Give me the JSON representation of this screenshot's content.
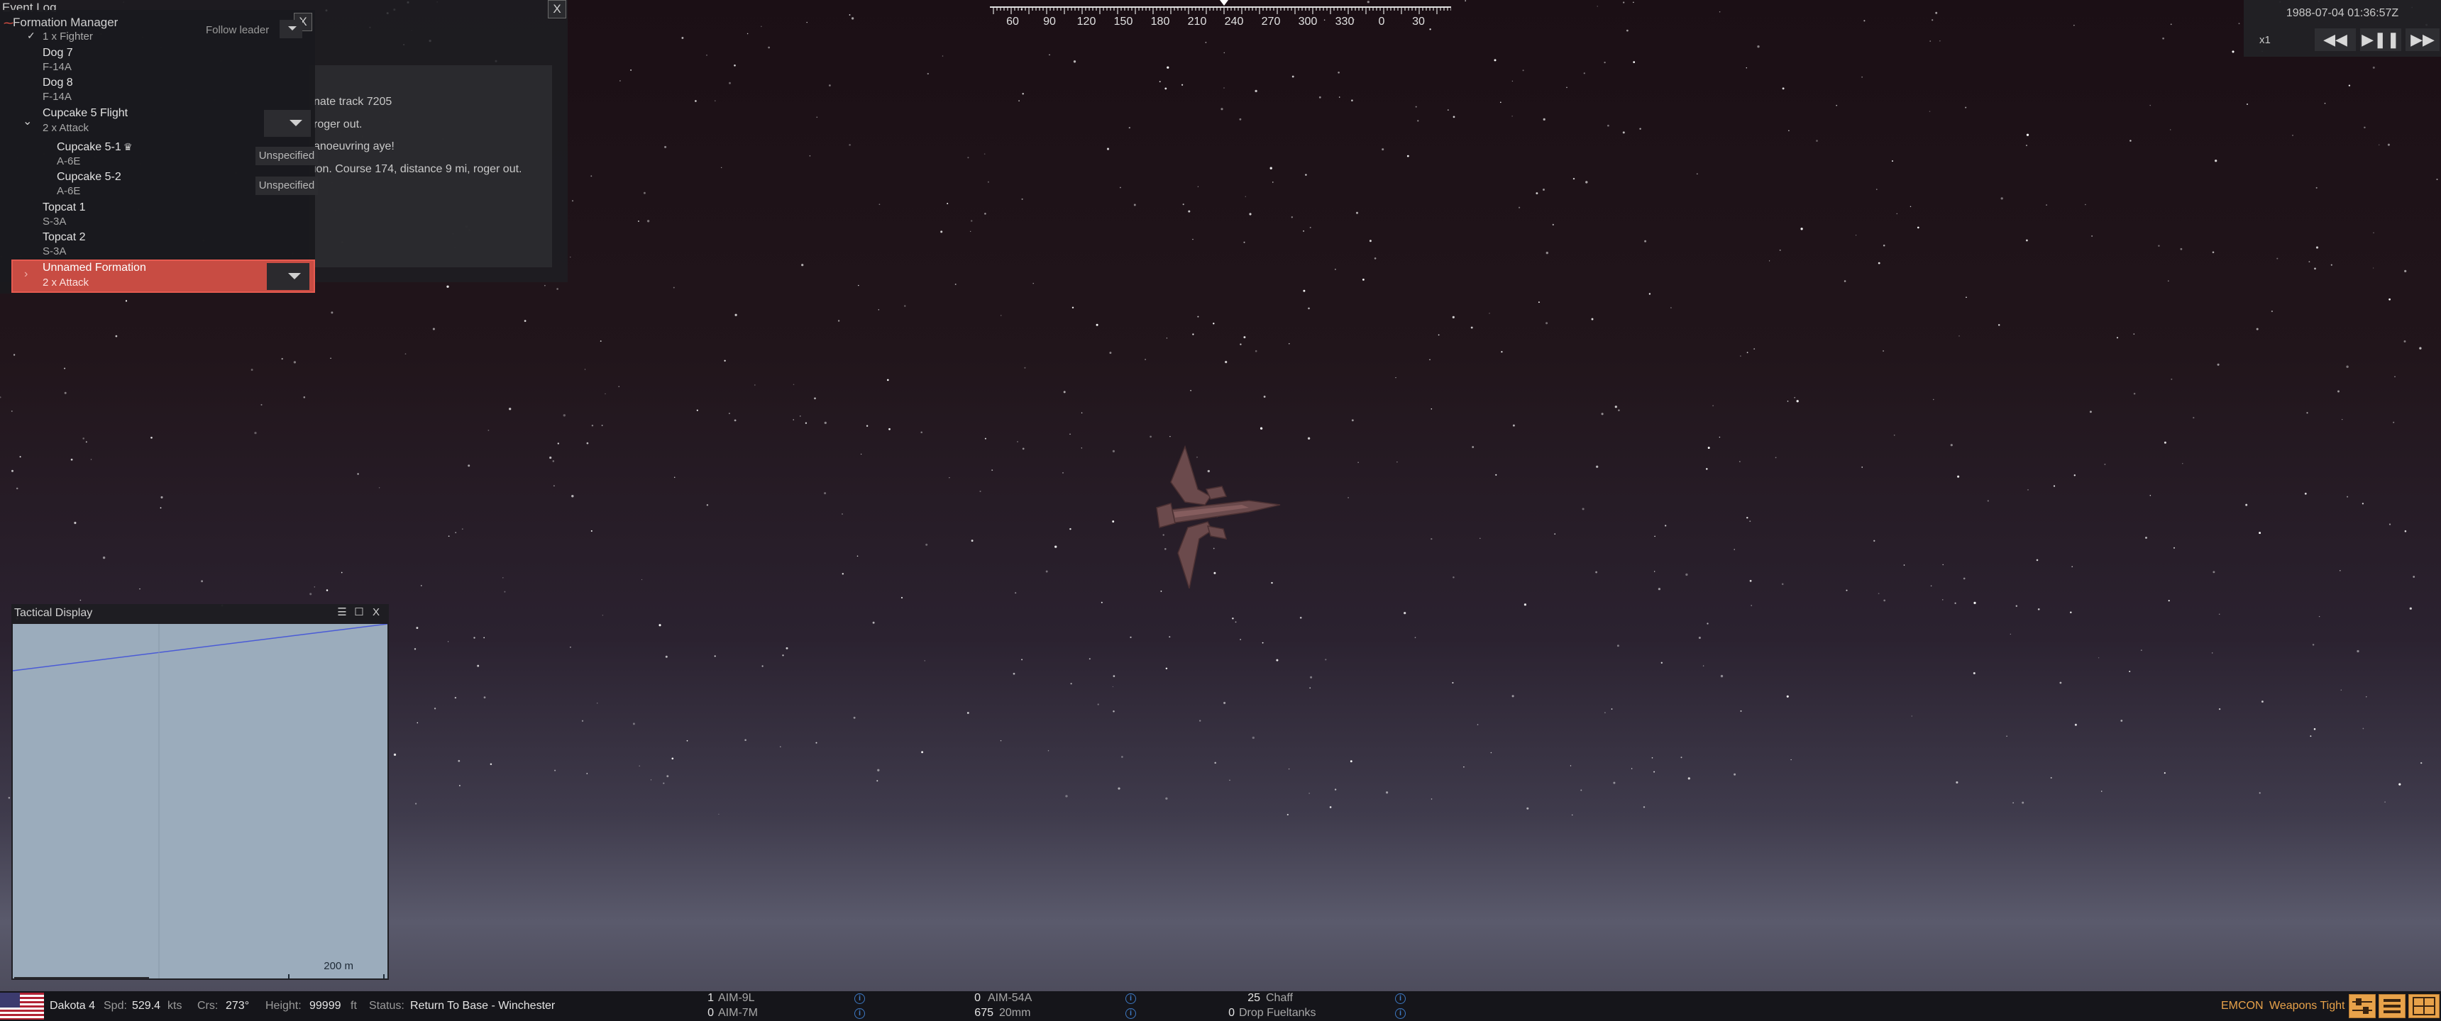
{
  "event_log": {
    "title": "Event Log",
    "close": "X",
    "messages": [
      "nate track 7205",
      "roger out.",
      "anoeuvring aye!",
      "ion. Course 174, distance 9 mi, roger out."
    ]
  },
  "formation_manager": {
    "title": "Formation Manager",
    "close": "X",
    "follow_leader": "Follow leader",
    "top_item_sub": "1 x Fighter",
    "items": [
      {
        "name": "Dog 7",
        "type": "F-14A"
      },
      {
        "name": "Dog 8",
        "type": "F-14A"
      }
    ],
    "group": {
      "name": "Cupcake 5 Flight",
      "sub": "2 x Attack",
      "members": [
        {
          "name": "Cupcake 5-1",
          "type": "A-6E",
          "role": "Unspecified",
          "leader": true
        },
        {
          "name": "Cupcake 5-2",
          "type": "A-6E",
          "role": "Unspecified",
          "leader": false
        }
      ]
    },
    "others": [
      {
        "name": "Topcat 1",
        "type": "S-3A"
      },
      {
        "name": "Topcat 2",
        "type": "S-3A"
      }
    ],
    "selected": {
      "name": "Unnamed Formation",
      "sub": "2 x Attack"
    }
  },
  "tactical_display": {
    "title": "Tactical Display",
    "close": "X",
    "scale": "200 m",
    "tools": [
      "ruler-icon",
      "pencil-icon",
      "compass-tool-icon",
      "eraser-icon"
    ]
  },
  "compass": {
    "labels": [
      "60",
      "90",
      "120",
      "150",
      "180",
      "210",
      "240",
      "270",
      "300",
      "330",
      "0",
      "30"
    ]
  },
  "time": {
    "datetime": "1988-07-04 01:36:57Z",
    "speed": "x1"
  },
  "status_bar": {
    "unit": "Dakota 4",
    "spd_label": "Spd:",
    "spd": "529.4",
    "spd_unit": "kts",
    "crs_label": "Crs:",
    "crs": "273°",
    "height_label": "Height:",
    "height": "99999",
    "height_unit": "ft",
    "status_label": "Status:",
    "status": "Return To Base - Winchester",
    "weapons": [
      {
        "qty": "1",
        "name": "AIM-9L"
      },
      {
        "qty": "0",
        "name": "AIM-7M"
      },
      {
        "qty": "0",
        "name": "AIM-54A"
      },
      {
        "qty": "675",
        "name": "20mm"
      },
      {
        "qty": "25",
        "name": "Chaff"
      },
      {
        "qty": "0",
        "name": "Drop Fueltanks"
      }
    ],
    "emcon": "EMCON",
    "weapons_state": "Weapons Tight"
  },
  "colors": {
    "accent": "#e8a24a",
    "selected_row": "#c84c43",
    "map_bg": "#9bacbc"
  }
}
